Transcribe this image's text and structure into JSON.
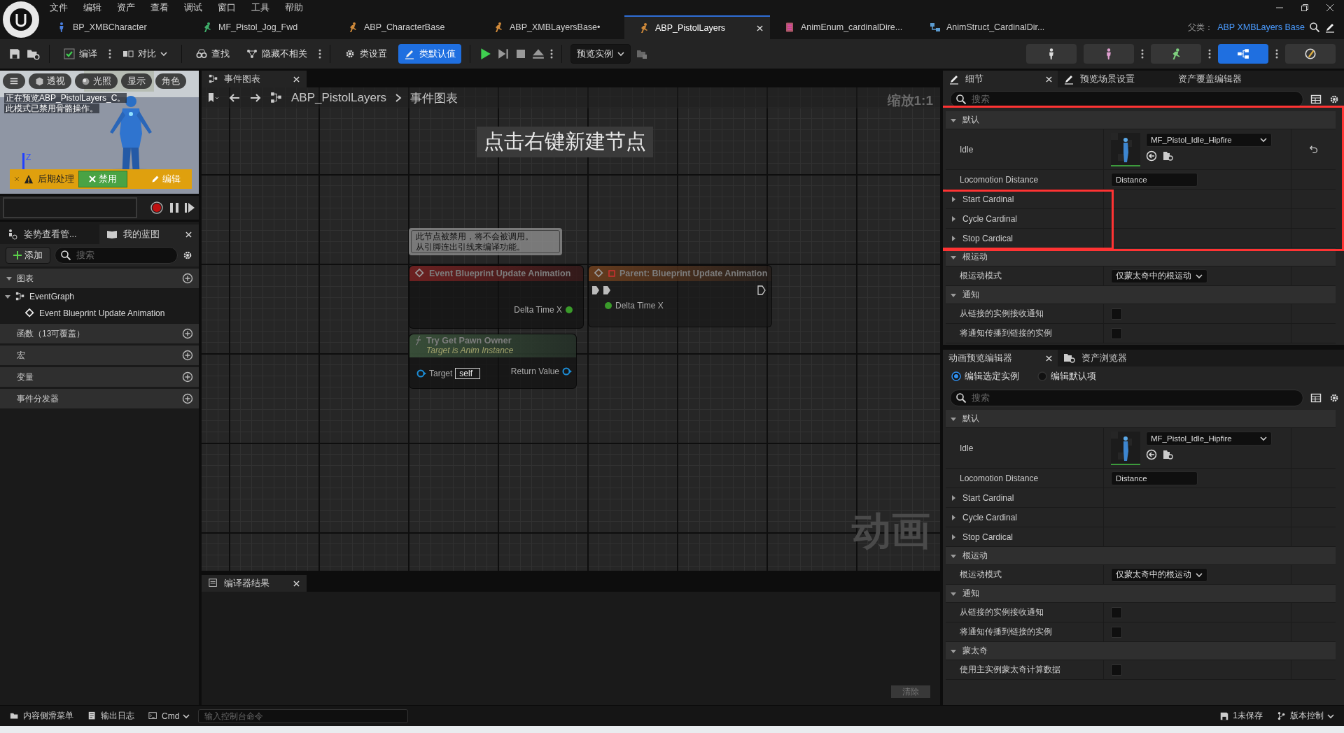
{
  "menu": [
    "文件",
    "编辑",
    "资产",
    "查看",
    "调试",
    "窗口",
    "工具",
    "帮助"
  ],
  "doc_tabs": [
    {
      "label": "BP_XMBCharacter",
      "kind": "blueprint",
      "selected": false
    },
    {
      "label": "MF_Pistol_Jog_Fwd",
      "kind": "sequence",
      "selected": false
    },
    {
      "label": "ABP_CharacterBase",
      "kind": "animbp",
      "selected": false
    },
    {
      "label": "ABP_XMBLayersBase•",
      "kind": "animbp",
      "selected": false
    },
    {
      "label": "ABP_PistolLayers",
      "kind": "animbp",
      "selected": true
    },
    {
      "label": "AnimEnum_cardinalDire...",
      "kind": "enum",
      "selected": false
    },
    {
      "label": "AnimStruct_CardinalDir...",
      "kind": "struct",
      "selected": false
    }
  ],
  "parent_class": {
    "label": "父类：",
    "value": "ABP XMBLayers Base"
  },
  "toolbar": {
    "compile": "编译",
    "diff": "对比",
    "find": "查找",
    "hide": "隐藏不相关",
    "class_settings": "类设置",
    "class_defaults": {
      "label": "类默认值",
      "selected": true
    },
    "preview": "预览实例"
  },
  "modes": [
    {
      "selected": false
    },
    {
      "selected": false
    },
    {
      "selected": false
    },
    {
      "selected": true
    },
    {
      "selected": false
    }
  ],
  "viewport": {
    "buttons": [
      "透视",
      "光照",
      "显示",
      "角色"
    ],
    "message": [
      "正在预览ABP_PistolLayers_C。",
      "此模式已禁用骨骼操作。"
    ],
    "axis": "Z",
    "notice": "后期处理",
    "disable": "禁用",
    "edit": "编辑"
  },
  "left_tabs": [
    {
      "label": "姿势查看管...",
      "selected": false
    },
    {
      "label": "我的蓝图",
      "selected": true
    }
  ],
  "add": "添加",
  "left_search": {
    "placeholder": "搜索"
  },
  "sections": [
    {
      "title": "图表",
      "expanded": true,
      "children": [
        {
          "label": "EventGraph",
          "kind": "graph",
          "expanded": true,
          "children": [
            {
              "label": "Event Blueprint Update Animation",
              "kind": "event"
            }
          ]
        }
      ]
    },
    {
      "title": "函数（13可覆盖）"
    },
    {
      "title": "宏"
    },
    {
      "title": "变量"
    },
    {
      "title": "事件分发器"
    }
  ],
  "graph": {
    "tab": "事件图表",
    "breadcrumb": [
      "ABP_PistolLayers",
      "事件图表"
    ],
    "zoom": "缩放1:1",
    "hint": "点击右键新建节点",
    "label": "动画",
    "comment": [
      "此节点被禁用，将不会被调用。",
      "从引脚连出引线来编译功能。"
    ],
    "nodes": [
      {
        "kind": "event",
        "title": "Event Blueprint Update Animation",
        "pin": "Delta Time X"
      },
      {
        "kind": "parent",
        "title": "Parent: Blueprint Update Animation",
        "pin": "Delta Time X"
      },
      {
        "kind": "function",
        "title": "Try Get Pawn Owner",
        "subtitle": "Target is Anim Instance",
        "input": "Target",
        "input_value": "self",
        "output": "Return Value"
      }
    ]
  },
  "compiler": {
    "tab": "编译器结果",
    "clear": "清除"
  },
  "details": {
    "tabs": [
      {
        "label": "细节",
        "selected": true
      },
      {
        "label": "预览场景设置",
        "selected": false
      },
      {
        "label": "资产覆盖编辑器",
        "selected": false
      }
    ],
    "search": {
      "placeholder": "搜索"
    },
    "sections": [
      {
        "title": "默认",
        "expanded": true,
        "highlighted": true,
        "rows": [
          {
            "kind": "asset",
            "label": "Idle",
            "value": "MF_Pistol_Idle_Hipfire",
            "modified": true,
            "highlighted": false
          },
          {
            "kind": "field",
            "label": "Locomotion Distance",
            "value": "Distance",
            "highlighted": false
          },
          {
            "kind": "struct",
            "label": "Start Cardinal",
            "expanded": false,
            "highlighted": true
          },
          {
            "kind": "struct",
            "label": "Cycle Cardinal",
            "expanded": false,
            "highlighted": true
          },
          {
            "kind": "struct",
            "label": "Stop Cardical",
            "expanded": false,
            "highlighted": true
          }
        ]
      },
      {
        "title": "根运动",
        "expanded": true,
        "highlighted": false,
        "rows": [
          {
            "kind": "enum",
            "label": "根运动模式",
            "value": "仅蒙太奇中的根运动",
            "highlighted": false
          }
        ]
      },
      {
        "title": "通知",
        "expanded": true,
        "highlighted": false,
        "rows": [
          {
            "kind": "checkbox",
            "label": "从链接的实例接收通知",
            "checked": false,
            "highlighted": false
          },
          {
            "kind": "checkbox",
            "label": "将通知传播到链接的实例",
            "checked": false,
            "highlighted": false
          }
        ]
      }
    ]
  },
  "preview_editor": {
    "tabs": [
      {
        "label": "动画预览编辑器",
        "selected": true
      },
      {
        "label": "资产浏览器",
        "selected": false
      }
    ],
    "radios": [
      {
        "label": "编辑选定实例",
        "selected": true
      },
      {
        "label": "编辑默认项",
        "selected": false
      }
    ],
    "search": {
      "placeholder": "搜索"
    },
    "sections": [
      {
        "title": "默认",
        "expanded": true,
        "rows": [
          {
            "kind": "asset",
            "label": "Idle",
            "value": "MF_Pistol_Idle_Hipfire",
            "modified": false
          },
          {
            "kind": "field",
            "label": "Locomotion Distance",
            "value": "Distance"
          },
          {
            "kind": "struct",
            "label": "Start Cardinal",
            "expanded": false
          },
          {
            "kind": "struct",
            "label": "Cycle Cardinal",
            "expanded": false
          },
          {
            "kind": "struct",
            "label": "Stop Cardical",
            "expanded": false
          }
        ]
      },
      {
        "title": "根运动",
        "expanded": true,
        "rows": [
          {
            "kind": "enum",
            "label": "根运动模式",
            "value": "仅蒙太奇中的根运动"
          }
        ]
      },
      {
        "title": "通知",
        "expanded": true,
        "rows": [
          {
            "kind": "checkbox",
            "label": "从链接的实例接收通知",
            "checked": false
          },
          {
            "kind": "checkbox",
            "label": "将通知传播到链接的实例",
            "checked": false
          }
        ]
      },
      {
        "title": "蒙太奇",
        "expanded": true,
        "rows": [
          {
            "kind": "checkbox",
            "label": "使用主实例蒙太奇计算数据",
            "checked": false
          }
        ]
      }
    ]
  },
  "status": {
    "content_drawer": "内容侧滑菜单",
    "output_log": "输出日志",
    "cmd": "Cmd",
    "console_placeholder": "输入控制台命令",
    "unsaved": "1未保存",
    "source_control": "版本控制"
  }
}
